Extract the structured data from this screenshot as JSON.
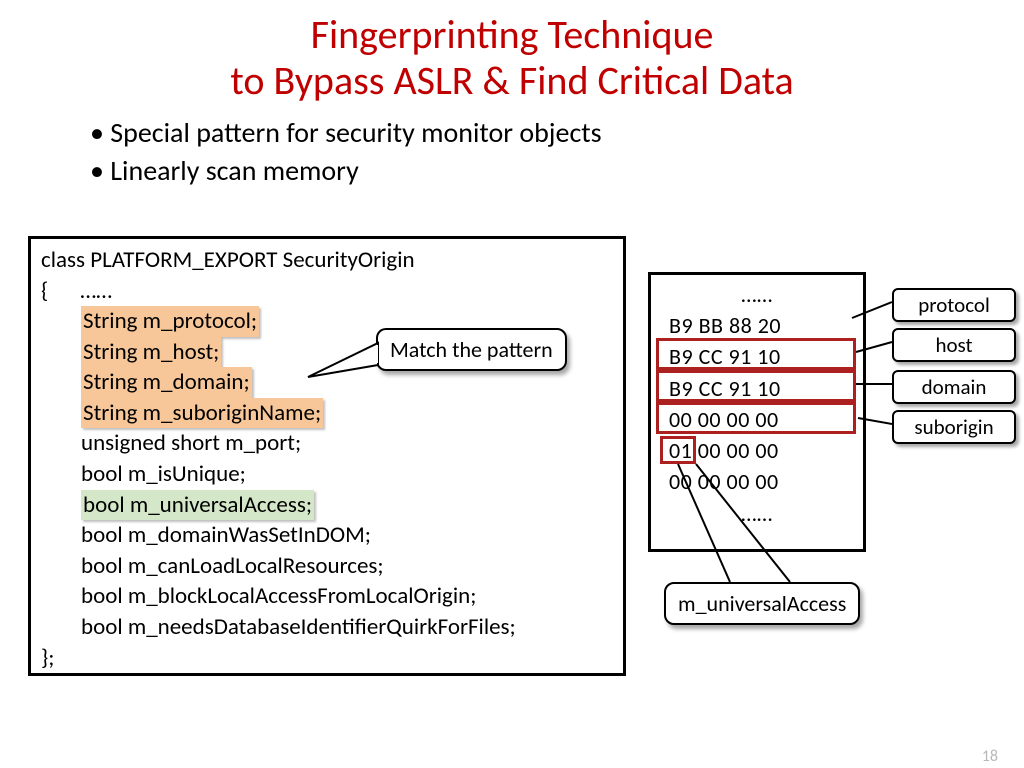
{
  "title_line1": "Fingerprinting Technique",
  "title_line2": "to Bypass ASLR & Find Critical Data",
  "bullets": [
    "Special pattern for security monitor objects",
    "Linearly scan memory"
  ],
  "code": {
    "header": "class PLATFORM_EXPORT SecurityOrigin",
    "open": "{",
    "dots": "……",
    "highlighted": [
      "String m_protocol;",
      "String m_host;",
      "String m_domain;",
      "String m_suboriginName;"
    ],
    "plain_after_orange": [
      "unsigned short m_port;",
      "bool m_isUnique;"
    ],
    "green": "bool m_universalAccess;",
    "plain_after_green": [
      "bool m_domainWasSetInDOM;",
      "bool m_canLoadLocalResources;",
      "bool m_blockLocalAccessFromLocalOrigin;",
      "bool m_needsDatabaseIdentifierQuirkForFiles;"
    ],
    "close": "};"
  },
  "callout_match": "Match the pattern",
  "callout_universal": "m_universalAccess",
  "hex": {
    "top_dots": "……",
    "rows": [
      "B9  BB  88  20",
      "B9  CC  91  10",
      "B9  CC  91  10",
      "00  00  00  00",
      "01  00  00  00",
      "00  00  00  00"
    ],
    "bottom_dots": "……",
    "first01": "01"
  },
  "labels": {
    "protocol": "protocol",
    "host": "host",
    "domain": "domain",
    "suborigin": "suborigin"
  },
  "page": "18"
}
